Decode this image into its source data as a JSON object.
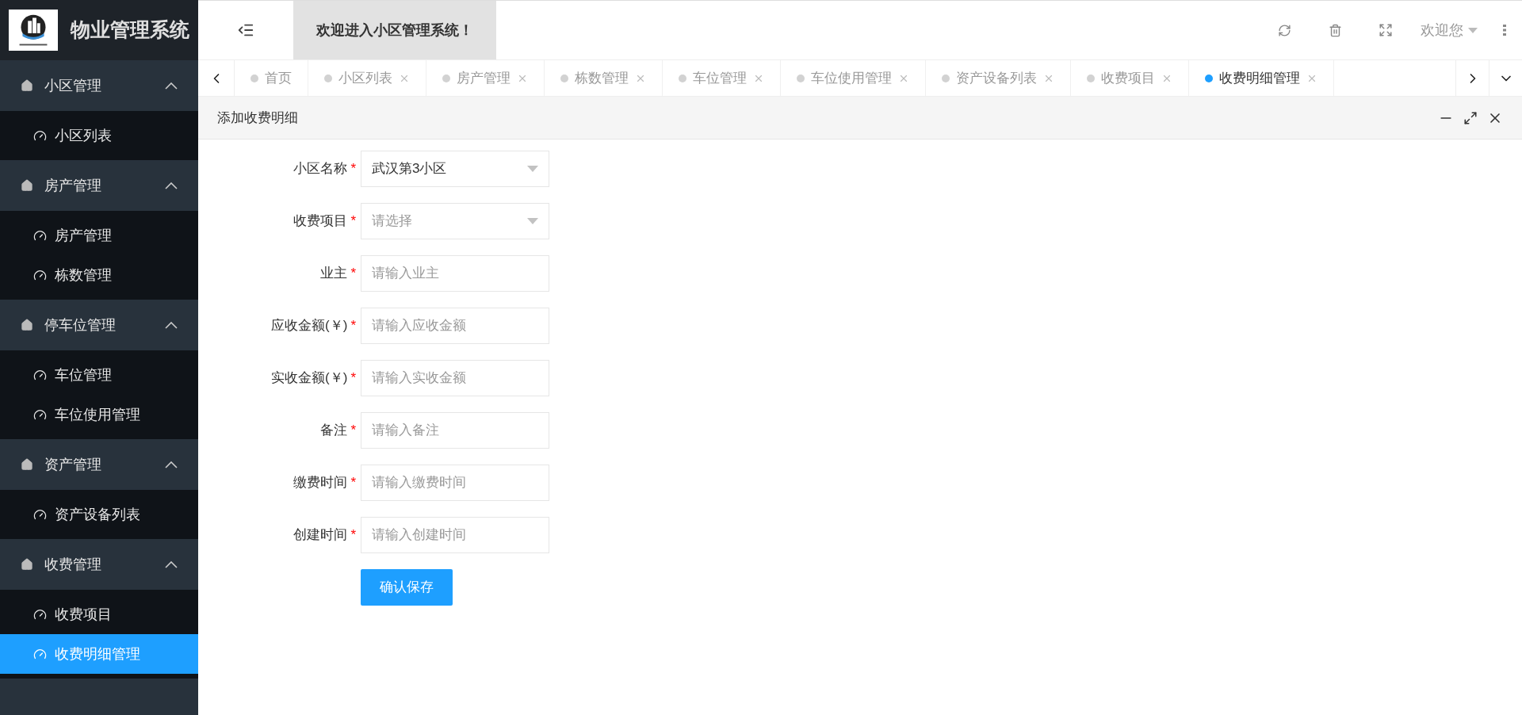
{
  "app": {
    "title": "物业管理系统"
  },
  "header": {
    "banner": "欢迎进入小区管理系统！",
    "user": "欢迎您"
  },
  "sidebar": {
    "groups": [
      {
        "label": "小区管理",
        "expanded": true,
        "items": [
          {
            "label": "小区列表",
            "selected": false
          }
        ]
      },
      {
        "label": "房产管理",
        "expanded": true,
        "items": [
          {
            "label": "房产管理",
            "selected": false
          },
          {
            "label": "栋数管理",
            "selected": false
          }
        ]
      },
      {
        "label": "停车位管理",
        "expanded": true,
        "items": [
          {
            "label": "车位管理",
            "selected": false
          },
          {
            "label": "车位使用管理",
            "selected": false
          }
        ]
      },
      {
        "label": "资产管理",
        "expanded": true,
        "items": [
          {
            "label": "资产设备列表",
            "selected": false
          }
        ]
      },
      {
        "label": "收费管理",
        "expanded": true,
        "items": [
          {
            "label": "收费项目",
            "selected": false
          },
          {
            "label": "收费明细管理",
            "selected": true
          }
        ]
      }
    ]
  },
  "tabs": [
    {
      "label": "首页",
      "selected": false,
      "closable": false
    },
    {
      "label": "小区列表",
      "selected": false,
      "closable": true
    },
    {
      "label": "房产管理",
      "selected": false,
      "closable": true
    },
    {
      "label": "栋数管理",
      "selected": false,
      "closable": true
    },
    {
      "label": "车位管理",
      "selected": false,
      "closable": true
    },
    {
      "label": "车位使用管理",
      "selected": false,
      "closable": true
    },
    {
      "label": "资产设备列表",
      "selected": false,
      "closable": true
    },
    {
      "label": "收费项目",
      "selected": false,
      "closable": true
    },
    {
      "label": "收费明细管理",
      "selected": true,
      "closable": true
    }
  ],
  "panel": {
    "title": "添加收费明细"
  },
  "form": {
    "fields": [
      {
        "kind": "select",
        "label": "小区名称",
        "required_mark": "*",
        "value": "武汉第3小区"
      },
      {
        "kind": "select",
        "label": "收费项目",
        "required_mark": "*",
        "placeholder": "请选择"
      },
      {
        "kind": "input",
        "label": "业主",
        "required_mark": "*",
        "placeholder": "请输入业主"
      },
      {
        "kind": "input",
        "label": "应收金额(￥)",
        "required_mark": "*",
        "placeholder": "请输入应收金额"
      },
      {
        "kind": "input",
        "label": "实收金额(￥)",
        "required_mark": "*",
        "placeholder": "请输入实收金额"
      },
      {
        "kind": "input",
        "label": "备注",
        "required_mark": "*",
        "placeholder": "请输入备注"
      },
      {
        "kind": "input",
        "label": "缴费时间",
        "required_mark": "*",
        "placeholder": "请输入缴费时间"
      },
      {
        "kind": "input",
        "label": "创建时间",
        "required_mark": "*",
        "placeholder": "请输入创建时间"
      }
    ],
    "submit": "确认保存"
  }
}
